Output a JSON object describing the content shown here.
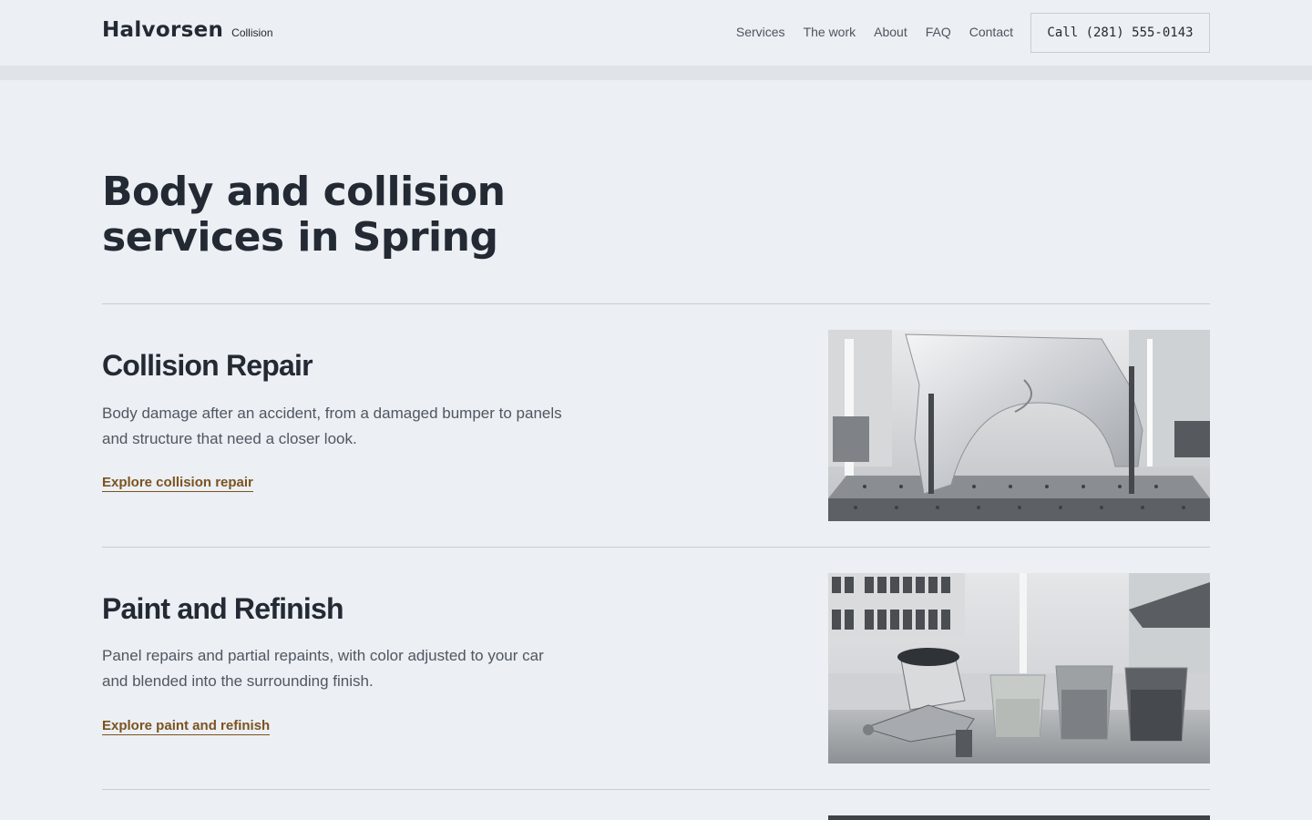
{
  "header": {
    "brand_name": "Halvorsen",
    "brand_sub": "Collision",
    "nav": [
      "Services",
      "The work",
      "About",
      "FAQ",
      "Contact"
    ],
    "call_label": "Call (281) 555-0143"
  },
  "hero": {
    "title": "Body and collision services in Spring"
  },
  "services": [
    {
      "title": "Collision Repair",
      "description": "Body damage after an accident, from a damaged bumper to panels and structure that need a closer look.",
      "link": "Explore collision repair",
      "image_icon": "fender-on-jig-photo"
    },
    {
      "title": "Paint and Refinish",
      "description": "Panel repairs and partial repaints, with color adjusted to your car and blended into the surrounding finish.",
      "link": "Explore paint and refinish",
      "image_icon": "spray-gun-paint-cups-photo"
    }
  ],
  "colors": {
    "background": "#eceff3",
    "text": "#232a33",
    "muted": "#4f5761",
    "link": "#7a5320",
    "rule": "#c9cdd3"
  }
}
